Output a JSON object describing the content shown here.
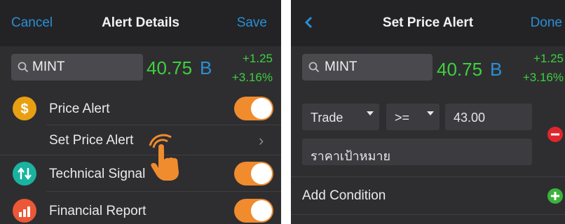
{
  "left": {
    "nav": {
      "cancel": "Cancel",
      "title": "Alert Details",
      "save": "Save"
    },
    "search": {
      "symbol": "MINT"
    },
    "quote": {
      "price": "40.75",
      "market": "B",
      "change": "+1.25",
      "percent": "+3.16%"
    },
    "rows": {
      "price_alert": "Price Alert",
      "set_price_alert": "Set Price Alert",
      "technical_signal": "Technical Signal",
      "financial_report": "Financial Report"
    },
    "icons": {
      "price_alert": "dollar-icon",
      "technical_signal": "arrows-icon",
      "financial_report": "chart-icon"
    },
    "toggles": {
      "price_alert": "on",
      "technical_signal": "on",
      "financial_report": "on"
    }
  },
  "right": {
    "nav": {
      "title": "Set Price Alert",
      "done": "Done"
    },
    "search": {
      "symbol": "MINT"
    },
    "quote": {
      "price": "40.75",
      "market": "B",
      "change": "+1.25",
      "percent": "+3.16%"
    },
    "condition": {
      "field": "Trade",
      "operator": ">=",
      "value": "43.00",
      "target_label": "ราคาเป้าหมาย"
    },
    "add_condition": "Add Condition"
  },
  "colors": {
    "accent": "#2a8fd6",
    "positive": "#3ed03e",
    "toggle_on": "#f08b2e",
    "remove": "#e0262c"
  }
}
